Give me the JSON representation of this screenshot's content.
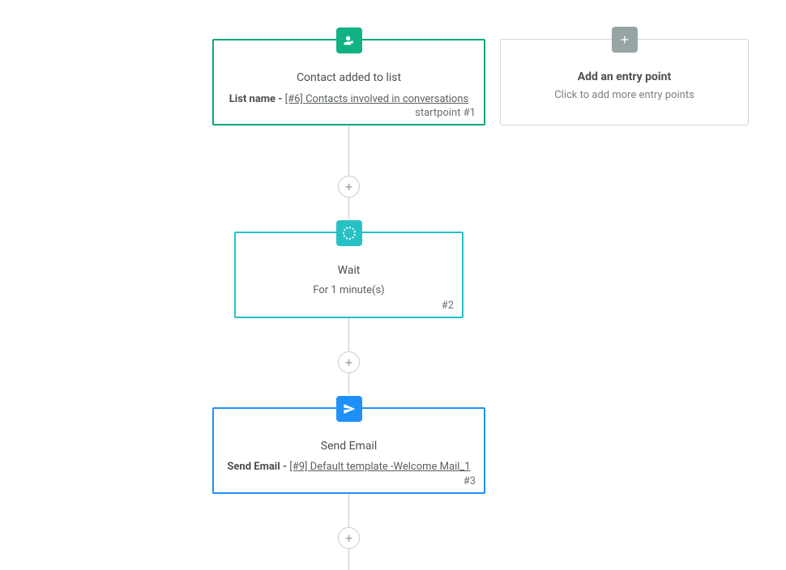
{
  "entry_node": {
    "title": "Contact added to list",
    "desc_prefix": "List name - ",
    "desc_link": "[#6] Contacts involved in conversations",
    "tag": "startpoint #1",
    "icon": "user-plus-icon",
    "color": "#10b183",
    "border": "#0aa77f"
  },
  "add_entry": {
    "title": "Add an entry point",
    "subtitle": "Click to add more entry points",
    "icon": "plus-icon",
    "color": "#96a4a4"
  },
  "wait_node": {
    "title": "Wait",
    "desc": "For 1 minute(s)",
    "tag": "#2",
    "icon": "wait-icon",
    "color": "#25c1c4"
  },
  "send_node": {
    "title": "Send Email",
    "desc_prefix": "Send Email - ",
    "desc_link": "[#9] Default template -Welcome Mail_1",
    "tag": "#3",
    "icon": "paper-plane-icon",
    "color": "#1f90f7"
  },
  "add_step_label": "+"
}
